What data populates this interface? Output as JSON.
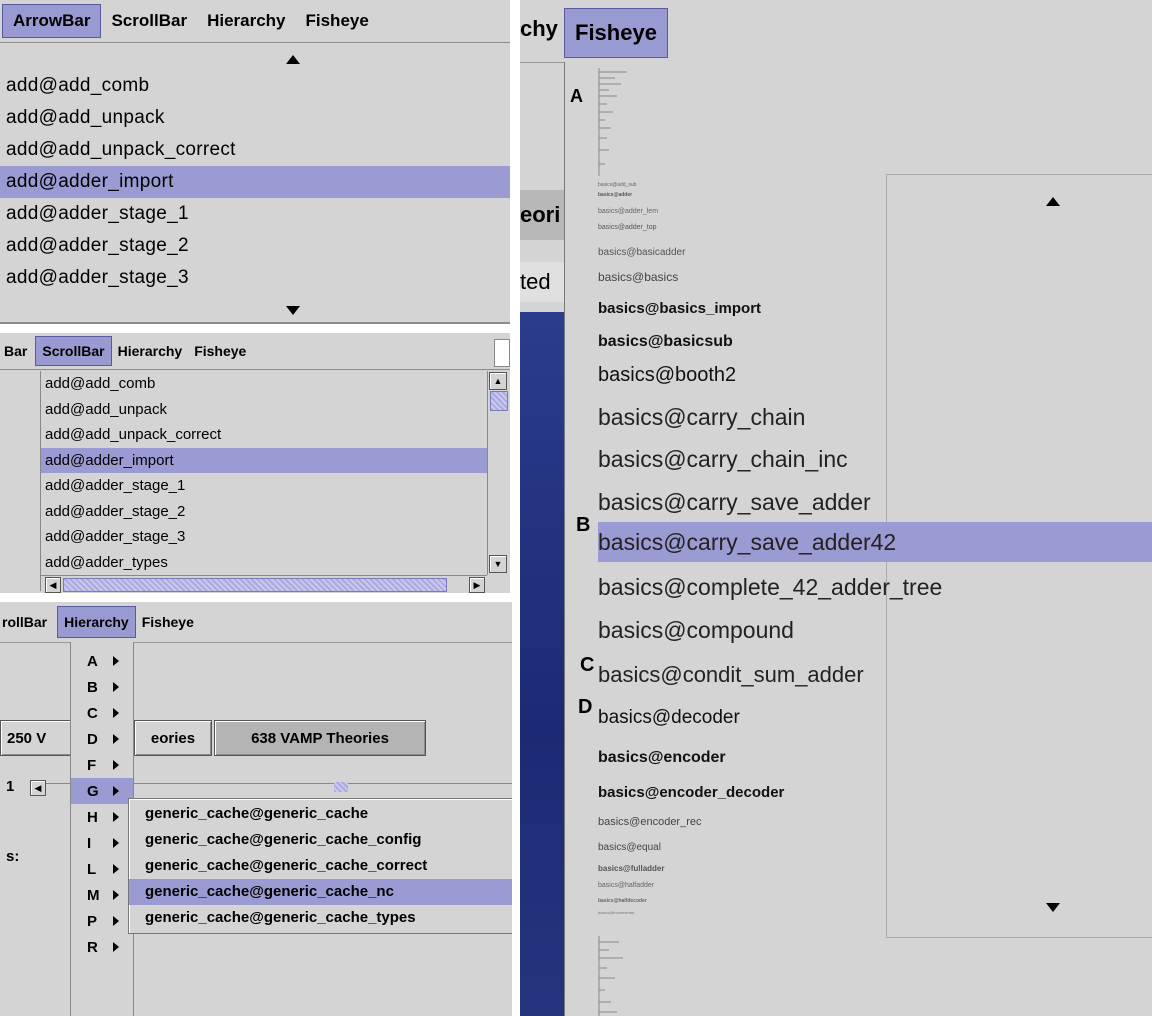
{
  "arrowbar": {
    "menus": [
      "ArrowBar",
      "ScrollBar",
      "Hierarchy",
      "Fisheye"
    ],
    "items": [
      "add@add_comb",
      "add@add_unpack",
      "add@add_unpack_correct",
      "add@adder_import",
      "add@adder_stage_1",
      "add@adder_stage_2",
      "add@adder_stage_3"
    ],
    "selected_index": 3
  },
  "scrollbar": {
    "menus": [
      "Bar",
      "ScrollBar",
      "Hierarchy",
      "Fisheye"
    ],
    "items": [
      "add@add_comb",
      "add@add_unpack",
      "add@add_unpack_correct",
      "add@adder_import",
      "add@adder_stage_1",
      "add@adder_stage_2",
      "add@adder_stage_3",
      "add@adder_types"
    ],
    "selected_index": 3
  },
  "hierarchy": {
    "menus": [
      "rollBar",
      "Hierarchy",
      "Fisheye"
    ],
    "letters": [
      "A",
      "B",
      "C",
      "D",
      "F",
      "G",
      "H",
      "I",
      "L",
      "M",
      "P",
      "R"
    ],
    "selected_letter": "G",
    "buttons": [
      "250 V",
      "eories",
      "638 VAMP Theories"
    ],
    "fragments": [
      "1",
      "s:"
    ],
    "submenu": [
      "generic_cache@generic_cache",
      "generic_cache@generic_cache_config",
      "generic_cache@generic_cache_correct",
      "generic_cache@generic_cache_nc",
      "generic_cache@generic_cache_types"
    ],
    "submenu_selected_index": 3
  },
  "fisheye": {
    "menus": [
      "chy",
      "Fisheye"
    ],
    "bg_fragments": [
      "eori",
      "ted"
    ],
    "letters": [
      "A",
      "B",
      "C",
      "D"
    ],
    "items": [
      "basics@add_sub",
      "basics@adder",
      "basics@adder_lem",
      "basics@adder_top",
      "basics@basicadder",
      "basics@basics",
      "basics@basics_import",
      "basics@basicsub",
      "basics@booth2",
      "basics@carry_chain",
      "basics@carry_chain_inc",
      "basics@carry_save_adder",
      "basics@carry_save_adder42",
      "basics@complete_42_adder_tree",
      "basics@compound",
      "basics@condit_sum_adder",
      "basics@decoder",
      "basics@encoder",
      "basics@encoder_decoder",
      "basics@encoder_rec",
      "basics@equal",
      "basics@fulladder",
      "basics@halfadder",
      "basics@halfdecoder",
      "basics@incrementer"
    ],
    "selected_index": 12
  }
}
